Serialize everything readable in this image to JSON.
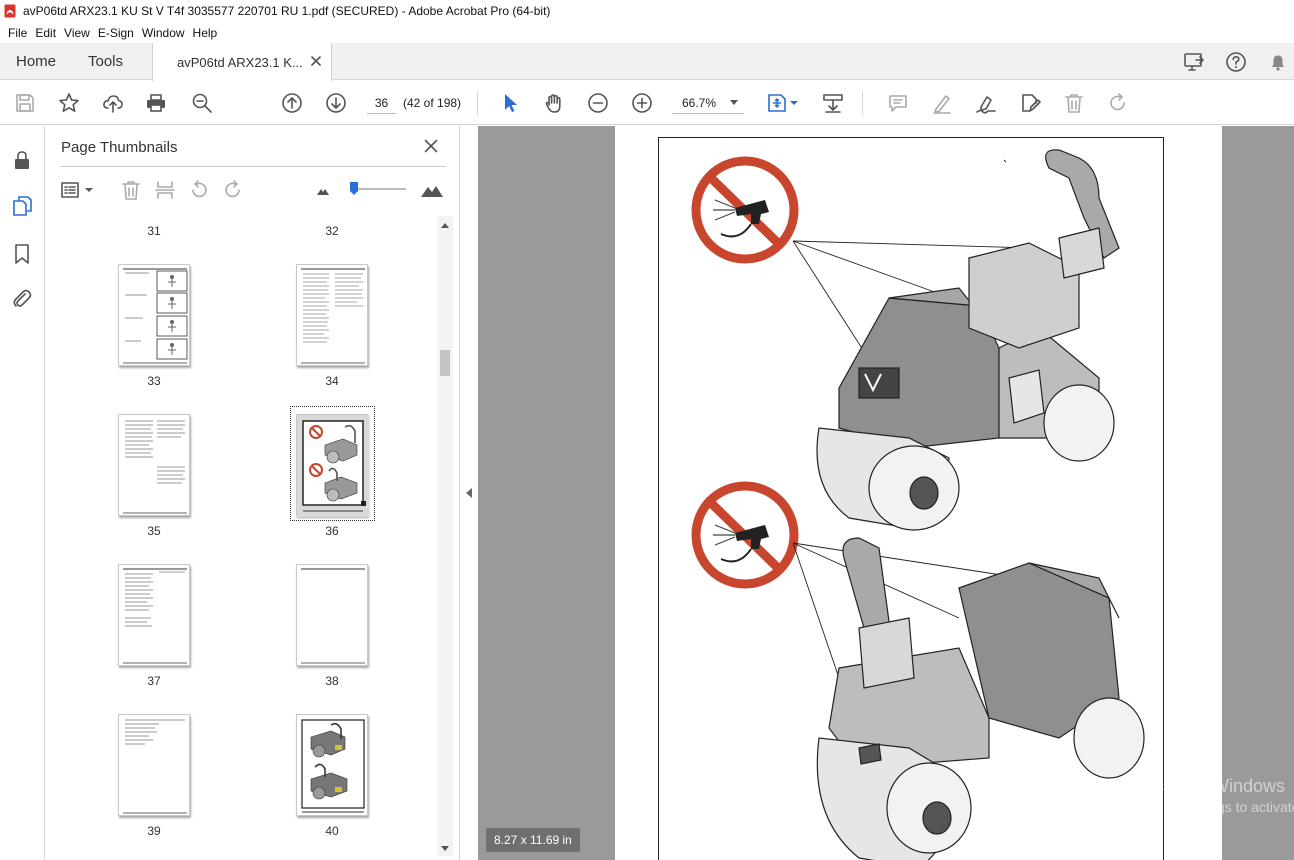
{
  "window": {
    "title": "avP06td ARX23.1 KU St V T4f 3035577 220701 RU 1.pdf (SECURED) - Adobe Acrobat Pro (64-bit)"
  },
  "menu": {
    "items": [
      "File",
      "Edit",
      "View",
      "E-Sign",
      "Window",
      "Help"
    ]
  },
  "tabs": {
    "home": "Home",
    "tools": "Tools",
    "document": "avP06td ARX23.1 K..."
  },
  "toolbar": {
    "current_page": "36",
    "page_count": "(42 of 198)",
    "zoom": "66.7%"
  },
  "thumbnails_panel": {
    "title": "Page Thumbnails",
    "rows": [
      {
        "left": "31",
        "right": "32"
      },
      {
        "left": "33",
        "right": "34"
      },
      {
        "left": "35",
        "right": "36"
      },
      {
        "left": "37",
        "right": "38"
      },
      {
        "left": "39",
        "right": "40"
      }
    ],
    "selected_page": "36"
  },
  "document": {
    "page_size": "8.27 x 11.69 in"
  },
  "overlay": {
    "activate_title": "Activate Windows",
    "activate_sub": "Go to Settings to activate Windows."
  },
  "colors": {
    "acrobat_red": "#d7362b",
    "selection_blue": "#2b6ed5",
    "prohibition_red": "#c8452e",
    "canvas_gray": "#9a9a9a"
  },
  "icons": {
    "left_rail": [
      "lock-icon",
      "page-thumbnails-icon",
      "bookmark-icon",
      "attachment-icon"
    ],
    "toolbar": [
      "save-icon",
      "star-icon",
      "upload-icon",
      "print-icon",
      "find-zoom-icon",
      "prev-page-icon",
      "next-page-icon",
      "select-cursor-icon",
      "hand-tool-icon",
      "zoom-out-icon",
      "zoom-in-icon",
      "fit-page-icon",
      "scroll-mode-icon",
      "comment-icon",
      "highlight-icon",
      "sign-icon",
      "edit-pdf-icon",
      "delete-icon",
      "redo-icon"
    ]
  }
}
